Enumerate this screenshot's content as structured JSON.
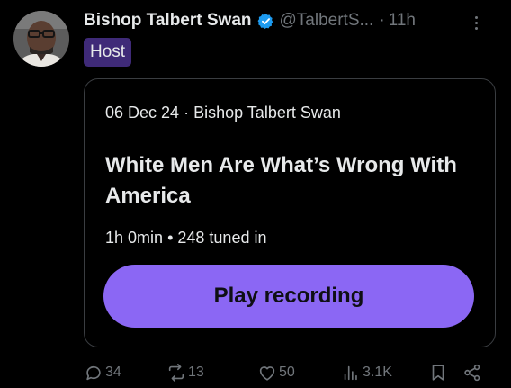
{
  "post": {
    "author": {
      "display_name": "Bishop Talbert Swan",
      "handle": "@TalbertS...",
      "verified": true,
      "role_badge": "Host"
    },
    "separator": "·",
    "time": "11h",
    "space_card": {
      "date": "06 Dec 24",
      "separator": "·",
      "host": "Bishop Talbert Swan",
      "title": "White Men Are What’s Wrong With America",
      "duration": "1h 0min",
      "stat_separator": "•",
      "listeners": "248 tuned in",
      "play_label": "Play recording"
    },
    "actions": {
      "replies": "34",
      "reposts": "13",
      "likes": "50",
      "views": "3.1K"
    }
  },
  "colors": {
    "background": "#000000",
    "primary_text": "#e7e9ea",
    "secondary_text": "#71767b",
    "verified_blue": "#1d9bf0",
    "host_badge_bg": "#3f2a78",
    "play_button": "#8b67f4",
    "card_border": "#3a3d41"
  },
  "icons": [
    "verified-badge-icon",
    "more-icon",
    "reply-icon",
    "repost-icon",
    "like-icon",
    "views-icon",
    "bookmark-icon",
    "share-icon"
  ]
}
